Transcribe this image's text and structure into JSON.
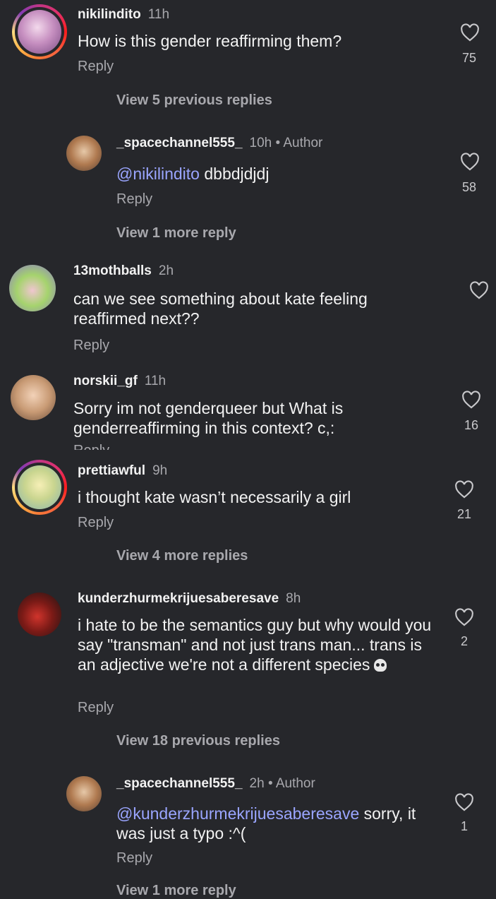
{
  "comments": [
    {
      "username": "nikilindito",
      "time": "11h",
      "text": "How is this gender reaffirming them?",
      "reply": "Reply",
      "likes": "75",
      "view_more": "View 5 previous replies"
    },
    {
      "username": "_spacechannel555_",
      "time": "10h",
      "author": "• Author",
      "mention": "@nikilindito",
      "text": " dbbdjdjdj",
      "reply": "Reply",
      "likes": "58",
      "view_more": "View 1 more reply"
    },
    {
      "username": "13mothballs",
      "time": "2h",
      "text": "can we see something about kate feeling reaffirmed next??",
      "reply": "Reply"
    },
    {
      "username": "norskii_gf",
      "time": "11h",
      "text": "Sorry im not genderqueer but What is genderreaffirming in this context? c,:",
      "reply": "Reply",
      "likes": "16"
    },
    {
      "username": "prettiawful",
      "time": "9h",
      "text": "i thought kate wasn’t necessarily a girl",
      "reply": "Reply",
      "likes": "21",
      "view_more": "View 4 more replies"
    },
    {
      "username": "kunderzhurmekrijuesaberesave",
      "time": "8h",
      "text": "i hate to be the semantics guy but why would you say \"transman\" and not just trans man... trans is an adjective we're not a different species",
      "emoji": "skull-emoji",
      "reply": "Reply",
      "likes": "2",
      "view_more": "View 18 previous replies"
    },
    {
      "username": "_spacechannel555_",
      "time": "2h",
      "author": "• Author",
      "mention": "@kunderzhurmekrijuesaberesave",
      "text": " sorry, it was just a typo :^(",
      "reply": "Reply",
      "likes": "1",
      "view_more": "View 1 more reply"
    }
  ],
  "icons": {
    "like": "heart-outline-icon",
    "avatar": "avatar"
  },
  "colors": {
    "background": "#26272b",
    "mention": "#9aa5ff",
    "muted": "#a8a8ad"
  }
}
